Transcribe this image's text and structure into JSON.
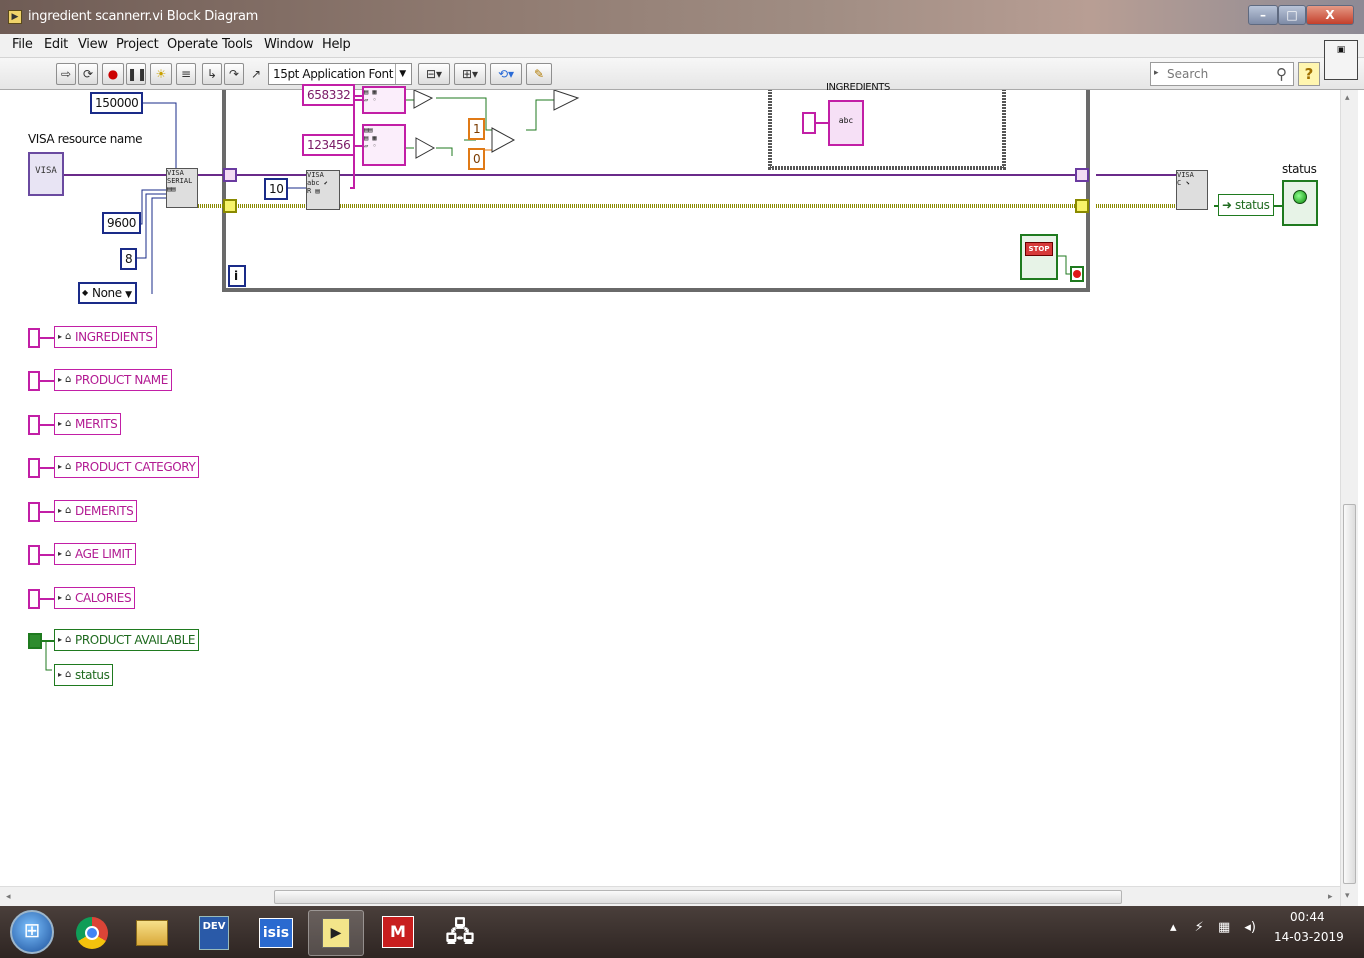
{
  "window": {
    "title": "ingredient scannerr.vi Block Diagram",
    "minimize": "–",
    "maximize": "□",
    "close": "X"
  },
  "menu": [
    "File",
    "Edit",
    "View",
    "Project",
    "Operate",
    "Tools",
    "Window",
    "Help"
  ],
  "toolbar": {
    "font_select": "15pt Application Font",
    "search_placeholder": "Search"
  },
  "diagram": {
    "constants": {
      "timeout": "150000",
      "baud_rate": "9600",
      "data_bits": "8",
      "parity": "None",
      "code_1": "658332",
      "code_2": "123456",
      "true_value": "1",
      "false_value": "0",
      "byte_count": "10"
    },
    "visa_label": "VISA resource name",
    "visa_control": "VISA",
    "ingredients_partial_label": "INGREDIENTS",
    "status_label": "status",
    "stop_label": "STOP",
    "status_local_top": "status",
    "iteration_terminal": "i",
    "local_variables": [
      {
        "name": "INGREDIENTS",
        "color": "#c21fa6"
      },
      {
        "name": "PRODUCT NAME",
        "color": "#c21fa6"
      },
      {
        "name": "MERITS",
        "color": "#c21fa6"
      },
      {
        "name": "PRODUCT CATEGORY",
        "color": "#c21fa6"
      },
      {
        "name": "DEMERITS",
        "color": "#c21fa6"
      },
      {
        "name": "AGE LIMIT",
        "color": "#c21fa6"
      },
      {
        "name": "CALORIES",
        "color": "#c21fa6"
      },
      {
        "name": "PRODUCT AVAILABLE",
        "color": "#1f7a1f"
      },
      {
        "name": "status",
        "color": "#1f7a1f"
      }
    ]
  },
  "taskbar": {
    "apps": [
      "chrome-icon",
      "file-explorer-icon",
      "dev-cpp-icon",
      "isis-icon",
      "labview-icon",
      "mplab-icon",
      "network-icon"
    ],
    "dev_label": "DEV",
    "isis_label": "isis",
    "time": "00:44",
    "date": "14-03-2019"
  }
}
